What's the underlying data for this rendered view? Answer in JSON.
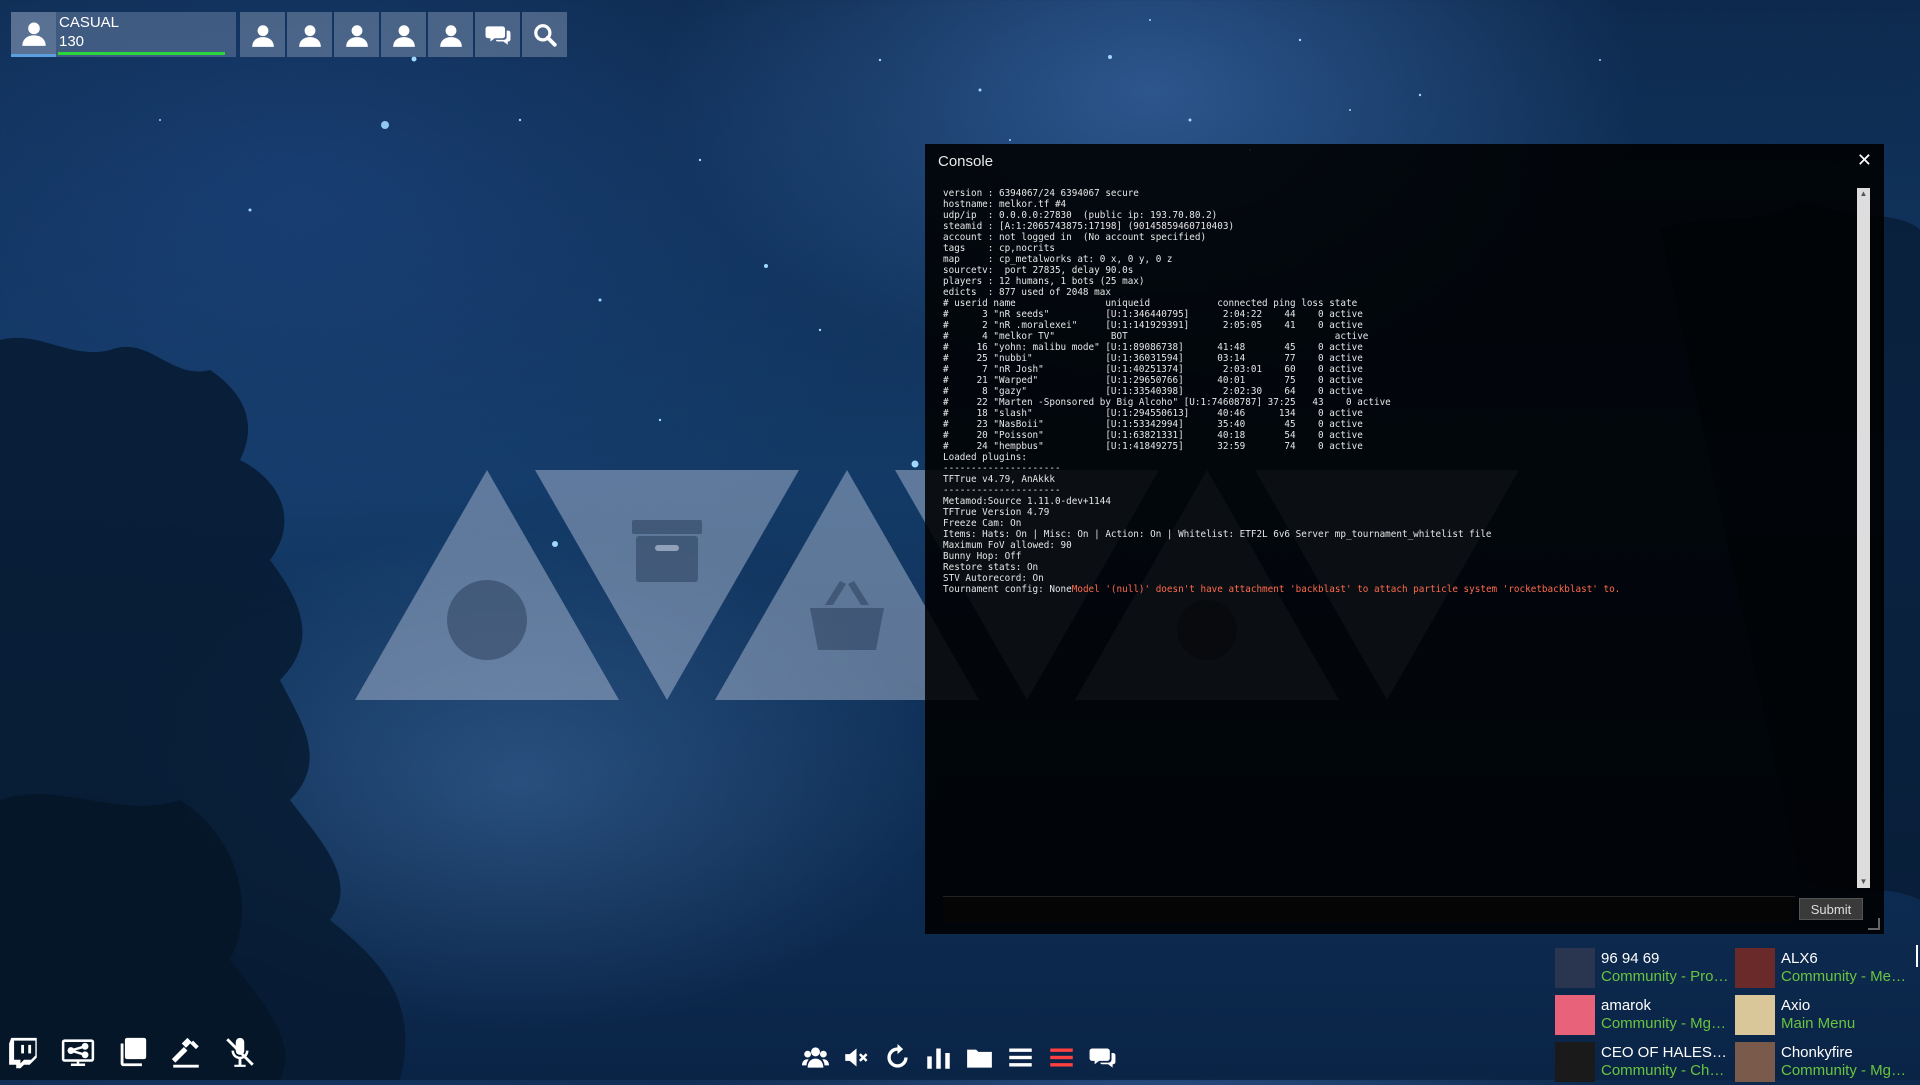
{
  "profile": {
    "mode": "CASUAL",
    "level": "130",
    "xp_fraction": 0.93
  },
  "topbar": {
    "icons": [
      "party-member-icon",
      "party-member-icon",
      "party-member-icon",
      "party-member-icon",
      "party-member-icon",
      "chat-icon",
      "search-icon"
    ]
  },
  "console": {
    "title": "Console",
    "close": "✕",
    "lines": [
      "version : 6394067/24 6394067 secure",
      "hostname: melkor.tf #4",
      "udp/ip  : 0.0.0.0:27830  (public ip: 193.70.80.2)",
      "steamid : [A:1:2065743875:17198] (90145859460710403)",
      "account : not logged in  (No account specified)",
      "tags    : cp,nocrits",
      "map     : cp_metalworks at: 0 x, 0 y, 0 z",
      "sourcetv:  port 27835, delay 90.0s",
      "players : 12 humans, 1 bots (25 max)",
      "edicts  : 877 used of 2048 max",
      "# userid name                uniqueid            connected ping loss state",
      "#      3 \"nR seeds\"          [U:1:346440795]      2:04:22    44    0 active",
      "#      2 \"nR .moralexei\"     [U:1:141929391]      2:05:05    41    0 active",
      "#      4 \"melkor TV\"          BOT                                     active",
      "#     16 \"yohn: malibu mode\" [U:1:89086738]      41:48       45    0 active",
      "#     25 \"nubbi\"             [U:1:36031594]      03:14       77    0 active",
      "#      7 \"nR Josh\"           [U:1:40251374]       2:03:01    60    0 active",
      "#     21 \"Warped\"            [U:1:29650766]      40:01       75    0 active",
      "#      8 \"gazy\"              [U:1:33540398]       2:02:30    64    0 active",
      "#     22 \"Marten -Sponsored by Big Alcoho\" [U:1:74608787] 37:25   43    0 active",
      "#     18 \"slash\"             [U:1:294550613]     40:46      134    0 active",
      "#     23 \"NasBoii\"           [U:1:53342994]      35:40       45    0 active",
      "#     20 \"Poisson\"           [U:1:63821331]      40:18       54    0 active",
      "#     24 \"hempbus\"           [U:1:41849275]      32:59       74    0 active",
      "Loaded plugins:",
      "---------------------",
      "TFTrue v4.79, AnAkkk",
      "---------------------",
      "Metamod:Source 1.11.0-dev+1144",
      "TFTrue Version 4.79",
      "Freeze Cam: On",
      "Items: Hats: On | Misc: On | Action: On | Whitelist: ETF2L 6v6 Server mp_tournament_whitelist file",
      "Maximum FoV allowed: 90",
      "Bunny Hop: Off",
      "Restore stats: On",
      "STV Autorecord: On"
    ],
    "last_line_prefix": "Tournament config: None",
    "last_line_error": "Model '(null)' doesn't have attachment 'backblast' to attach particle system 'rocketbackblast' to.",
    "input_value": "",
    "submit_label": "Submit",
    "scroll_up": "▲",
    "scroll_down": "▼"
  },
  "menu_triangles": [
    "globe-icon",
    "inventory-box-icon",
    "shop-basket-icon",
    "menu-icon-4",
    "gear-icon",
    "menu-icon-6"
  ],
  "bottom_left_icons": [
    "twitch-icon",
    "server-browser-icon",
    "copy-windows-icon",
    "hammer-icon",
    "mute-mic-icon"
  ],
  "bottom_center_icons": [
    "friends-icon",
    "mute-sound-icon",
    "reload-icon",
    "stats-icon",
    "folder-icon",
    "list-icon",
    "menu-red-icon",
    "chat-icon"
  ],
  "accent_red": "#ff4040",
  "friends": [
    {
      "name": "96 94 69",
      "status": "Community - Proc...",
      "avatar_color": "#2a3550"
    },
    {
      "name": "ALX6",
      "status": "Community - Meta...",
      "avatar_color": "#6b2a2a"
    },
    {
      "name": "amarok",
      "status": "Community - Mge ...",
      "avatar_color": "#e8627a"
    },
    {
      "name": "Axio",
      "status": "Main Menu",
      "avatar_color": "#d9c79a"
    },
    {
      "name": "CEO OF HALES O...",
      "status": "Community - Cha...",
      "avatar_color": "#1a1a1a"
    },
    {
      "name": "Chonkyfire",
      "status": "Community - Mge ...",
      "avatar_color": "#7a5a4a"
    }
  ]
}
